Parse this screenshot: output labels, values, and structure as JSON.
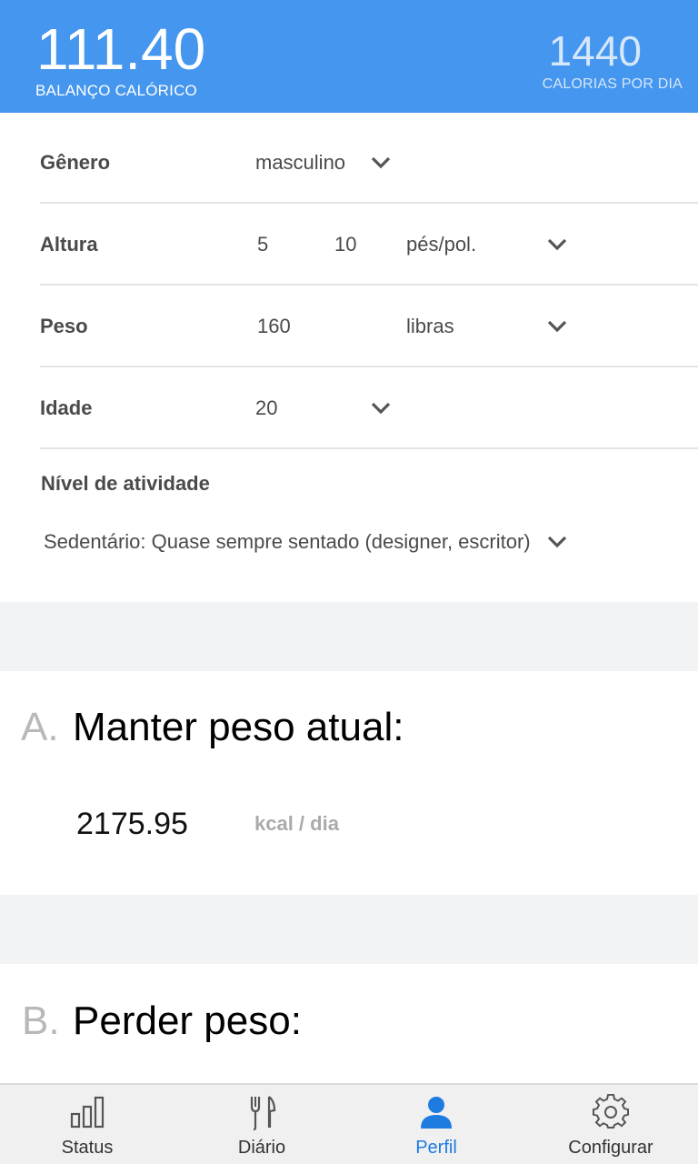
{
  "header": {
    "balance_value": "111.40",
    "balance_label": "BALANÇO CALÓRICO",
    "calories_value": "1440",
    "calories_label": "CALORIAS POR DIA"
  },
  "profile": {
    "gender": {
      "label": "Gênero",
      "value": "masculino"
    },
    "height": {
      "label": "Altura",
      "feet": "5",
      "inches": "10",
      "unit": "pés/pol."
    },
    "weight": {
      "label": "Peso",
      "value": "160",
      "unit": "libras"
    },
    "age": {
      "label": "Idade",
      "value": "20"
    },
    "activity": {
      "label": "Nível de atividade",
      "value": "Sedentário: Quase sempre sentado (designer, escritor)"
    }
  },
  "sections": {
    "a": {
      "letter": "A.",
      "title": "Manter peso atual:",
      "value": "2175.95",
      "unit": "kcal / dia"
    },
    "b": {
      "letter": "B.",
      "title": "Perder peso:"
    }
  },
  "tabs": [
    {
      "label": "Status",
      "icon": "bar-chart-icon",
      "active": false
    },
    {
      "label": "Diário",
      "icon": "fork-knife-icon",
      "active": false
    },
    {
      "label": "Perfil",
      "icon": "person-icon",
      "active": true
    },
    {
      "label": "Configurar",
      "icon": "gear-icon",
      "active": false
    }
  ],
  "colors": {
    "header_bg": "#4596EE",
    "active_tab": "#1E7BE0",
    "section_gap": "#F2F3F5"
  }
}
